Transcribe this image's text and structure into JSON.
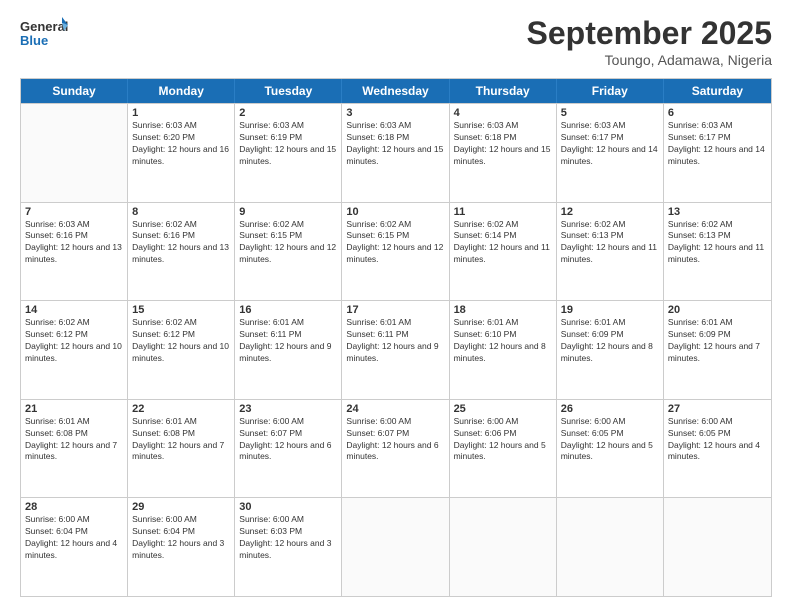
{
  "header": {
    "logo": {
      "general": "General",
      "blue": "Blue"
    },
    "title": "September 2025",
    "location": "Toungo, Adamawa, Nigeria"
  },
  "weekdays": [
    "Sunday",
    "Monday",
    "Tuesday",
    "Wednesday",
    "Thursday",
    "Friday",
    "Saturday"
  ],
  "weeks": [
    [
      {
        "day": "",
        "empty": true
      },
      {
        "day": "1",
        "sunrise": "6:03 AM",
        "sunset": "6:20 PM",
        "daylight": "12 hours and 16 minutes."
      },
      {
        "day": "2",
        "sunrise": "6:03 AM",
        "sunset": "6:19 PM",
        "daylight": "12 hours and 15 minutes."
      },
      {
        "day": "3",
        "sunrise": "6:03 AM",
        "sunset": "6:18 PM",
        "daylight": "12 hours and 15 minutes."
      },
      {
        "day": "4",
        "sunrise": "6:03 AM",
        "sunset": "6:18 PM",
        "daylight": "12 hours and 15 minutes."
      },
      {
        "day": "5",
        "sunrise": "6:03 AM",
        "sunset": "6:17 PM",
        "daylight": "12 hours and 14 minutes."
      },
      {
        "day": "6",
        "sunrise": "6:03 AM",
        "sunset": "6:17 PM",
        "daylight": "12 hours and 14 minutes."
      }
    ],
    [
      {
        "day": "7",
        "sunrise": "6:03 AM",
        "sunset": "6:16 PM",
        "daylight": "12 hours and 13 minutes."
      },
      {
        "day": "8",
        "sunrise": "6:02 AM",
        "sunset": "6:16 PM",
        "daylight": "12 hours and 13 minutes."
      },
      {
        "day": "9",
        "sunrise": "6:02 AM",
        "sunset": "6:15 PM",
        "daylight": "12 hours and 12 minutes."
      },
      {
        "day": "10",
        "sunrise": "6:02 AM",
        "sunset": "6:15 PM",
        "daylight": "12 hours and 12 minutes."
      },
      {
        "day": "11",
        "sunrise": "6:02 AM",
        "sunset": "6:14 PM",
        "daylight": "12 hours and 11 minutes."
      },
      {
        "day": "12",
        "sunrise": "6:02 AM",
        "sunset": "6:13 PM",
        "daylight": "12 hours and 11 minutes."
      },
      {
        "day": "13",
        "sunrise": "6:02 AM",
        "sunset": "6:13 PM",
        "daylight": "12 hours and 11 minutes."
      }
    ],
    [
      {
        "day": "14",
        "sunrise": "6:02 AM",
        "sunset": "6:12 PM",
        "daylight": "12 hours and 10 minutes."
      },
      {
        "day": "15",
        "sunrise": "6:02 AM",
        "sunset": "6:12 PM",
        "daylight": "12 hours and 10 minutes."
      },
      {
        "day": "16",
        "sunrise": "6:01 AM",
        "sunset": "6:11 PM",
        "daylight": "12 hours and 9 minutes."
      },
      {
        "day": "17",
        "sunrise": "6:01 AM",
        "sunset": "6:11 PM",
        "daylight": "12 hours and 9 minutes."
      },
      {
        "day": "18",
        "sunrise": "6:01 AM",
        "sunset": "6:10 PM",
        "daylight": "12 hours and 8 minutes."
      },
      {
        "day": "19",
        "sunrise": "6:01 AM",
        "sunset": "6:09 PM",
        "daylight": "12 hours and 8 minutes."
      },
      {
        "day": "20",
        "sunrise": "6:01 AM",
        "sunset": "6:09 PM",
        "daylight": "12 hours and 7 minutes."
      }
    ],
    [
      {
        "day": "21",
        "sunrise": "6:01 AM",
        "sunset": "6:08 PM",
        "daylight": "12 hours and 7 minutes."
      },
      {
        "day": "22",
        "sunrise": "6:01 AM",
        "sunset": "6:08 PM",
        "daylight": "12 hours and 7 minutes."
      },
      {
        "day": "23",
        "sunrise": "6:00 AM",
        "sunset": "6:07 PM",
        "daylight": "12 hours and 6 minutes."
      },
      {
        "day": "24",
        "sunrise": "6:00 AM",
        "sunset": "6:07 PM",
        "daylight": "12 hours and 6 minutes."
      },
      {
        "day": "25",
        "sunrise": "6:00 AM",
        "sunset": "6:06 PM",
        "daylight": "12 hours and 5 minutes."
      },
      {
        "day": "26",
        "sunrise": "6:00 AM",
        "sunset": "6:05 PM",
        "daylight": "12 hours and 5 minutes."
      },
      {
        "day": "27",
        "sunrise": "6:00 AM",
        "sunset": "6:05 PM",
        "daylight": "12 hours and 4 minutes."
      }
    ],
    [
      {
        "day": "28",
        "sunrise": "6:00 AM",
        "sunset": "6:04 PM",
        "daylight": "12 hours and 4 minutes."
      },
      {
        "day": "29",
        "sunrise": "6:00 AM",
        "sunset": "6:04 PM",
        "daylight": "12 hours and 3 minutes."
      },
      {
        "day": "30",
        "sunrise": "6:00 AM",
        "sunset": "6:03 PM",
        "daylight": "12 hours and 3 minutes."
      },
      {
        "day": "",
        "empty": true
      },
      {
        "day": "",
        "empty": true
      },
      {
        "day": "",
        "empty": true
      },
      {
        "day": "",
        "empty": true
      }
    ]
  ]
}
